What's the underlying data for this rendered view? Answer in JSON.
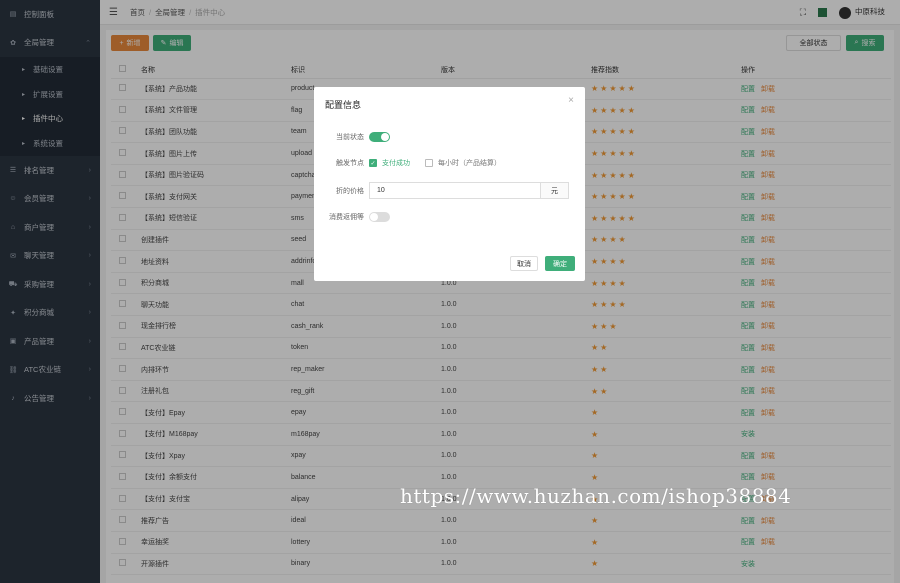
{
  "sidebar": {
    "items": [
      {
        "label": "控制面板",
        "icon": "dashboard-icon"
      },
      {
        "label": "全局管理",
        "icon": "gear-icon"
      }
    ],
    "subitems": [
      {
        "label": "基础设置"
      },
      {
        "label": "扩展设置"
      },
      {
        "label": "插件中心"
      },
      {
        "label": "系统设置"
      }
    ],
    "items2": [
      {
        "label": "排名管理",
        "icon": "list-icon"
      },
      {
        "label": "会员管理",
        "icon": "user-icon"
      },
      {
        "label": "商户管理",
        "icon": "store-icon"
      },
      {
        "label": "聊天管理",
        "icon": "chat-icon"
      },
      {
        "label": "采购管理",
        "icon": "cart-icon"
      },
      {
        "label": "积分商城",
        "icon": "gift-icon"
      },
      {
        "label": "产品管理",
        "icon": "box-icon"
      },
      {
        "label": "ATC农业链",
        "icon": "chain-icon"
      },
      {
        "label": "公告管理",
        "icon": "bell-icon"
      }
    ]
  },
  "topbar": {
    "crumbs": [
      "首页",
      "全局管理",
      "插件中心"
    ],
    "user": "中原科技"
  },
  "toolbar": {
    "btn1": "新增",
    "btn2": "编辑",
    "status_select": "全部状态",
    "search": "搜索"
  },
  "table": {
    "headers": [
      "名称",
      "标识",
      "版本",
      "推荐指数",
      "操作"
    ],
    "rows": [
      {
        "name": "【系统】产品功能",
        "key": "product",
        "ver": "",
        "stars": 5,
        "ops": [
          "配置",
          "卸载"
        ]
      },
      {
        "name": "【系统】文件管理",
        "key": "flag",
        "ver": "",
        "stars": 5,
        "ops": [
          "配置",
          "卸载"
        ]
      },
      {
        "name": "【系统】团队功能",
        "key": "team",
        "ver": "",
        "stars": 5,
        "ops": [
          "配置",
          "卸载"
        ]
      },
      {
        "name": "【系统】图片上传",
        "key": "upload",
        "ver": "",
        "stars": 5,
        "ops": [
          "配置",
          "卸载"
        ]
      },
      {
        "name": "【系统】图片验证码",
        "key": "captcha",
        "ver": "",
        "stars": 5,
        "ops": [
          "配置",
          "卸载"
        ]
      },
      {
        "name": "【系统】支付网关",
        "key": "payment",
        "ver": "",
        "stars": 5,
        "ops": [
          "配置",
          "卸载"
        ]
      },
      {
        "name": "【系统】短信验证",
        "key": "sms",
        "ver": "",
        "stars": 5,
        "ops": [
          "配置",
          "卸载"
        ]
      },
      {
        "name": "创建插件",
        "key": "seed",
        "ver": "",
        "stars": 4,
        "ops": [
          "配置",
          "卸载"
        ]
      },
      {
        "name": "地址资料",
        "key": "addrinfo",
        "ver": "",
        "stars": 4,
        "ops": [
          "配置",
          "卸载"
        ]
      },
      {
        "name": "积分商城",
        "key": "mall",
        "ver": "1.0.0",
        "stars": 4,
        "ops": [
          "配置",
          "卸载"
        ]
      },
      {
        "name": "聊天功能",
        "key": "chat",
        "ver": "1.0.0",
        "stars": 4,
        "ops": [
          "配置",
          "卸载"
        ]
      },
      {
        "name": "现金排行榜",
        "key": "cash_rank",
        "ver": "1.0.0",
        "stars": 3,
        "ops": [
          "配置",
          "卸载"
        ]
      },
      {
        "name": "ATC农业链",
        "key": "token",
        "ver": "1.0.0",
        "stars": 2,
        "ops": [
          "配置",
          "卸载"
        ]
      },
      {
        "name": "内排环节",
        "key": "rep_maker",
        "ver": "1.0.0",
        "stars": 2,
        "ops": [
          "配置",
          "卸载"
        ]
      },
      {
        "name": "注册礼包",
        "key": "reg_gift",
        "ver": "1.0.0",
        "stars": 2,
        "ops": [
          "配置",
          "卸载"
        ]
      },
      {
        "name": "【支付】Epay",
        "key": "epay",
        "ver": "1.0.0",
        "stars": 1,
        "ops": [
          "配置",
          "卸载"
        ]
      },
      {
        "name": "【支付】M168pay",
        "key": "m168pay",
        "ver": "1.0.0",
        "stars": 1,
        "ops": [
          "安装"
        ]
      },
      {
        "name": "【支付】Xpay",
        "key": "xpay",
        "ver": "1.0.0",
        "stars": 1,
        "ops": [
          "配置",
          "卸载"
        ]
      },
      {
        "name": "【支付】余额支付",
        "key": "balance",
        "ver": "1.0.0",
        "stars": 1,
        "ops": [
          "配置",
          "卸载"
        ]
      },
      {
        "name": "【支付】支付宝",
        "key": "alipay",
        "ver": "1.0.0",
        "stars": 1,
        "ops": [
          "配置",
          "卸载"
        ]
      },
      {
        "name": "推荐广告",
        "key": "ideal",
        "ver": "1.0.0",
        "stars": 1,
        "ops": [
          "配置",
          "卸载"
        ]
      },
      {
        "name": "幸运抽奖",
        "key": "lottery",
        "ver": "1.0.0",
        "stars": 1,
        "ops": [
          "配置",
          "卸载"
        ]
      },
      {
        "name": "开源插件",
        "key": "binary",
        "ver": "1.0.0",
        "stars": 1,
        "ops": [
          "安装"
        ]
      }
    ]
  },
  "modal": {
    "title": "配置信息",
    "status_label": "当前状态",
    "status_on": true,
    "node_label": "触发节点",
    "node_option1": "支付成功",
    "node_option2": "每小时（产品结算）",
    "price_label": "折的价格",
    "price_value": "10",
    "price_unit": "元",
    "extra_label": "消费返佣等",
    "extra_on": false,
    "cancel": "取消",
    "confirm": "确定"
  },
  "watermark": "https://www.huzhan.com/ishop38884",
  "colors": {
    "accent_green": "#3fae7a",
    "accent_orange": "#e98a3d",
    "star": "#f29a34",
    "sidebar_bg": "#2b3542"
  }
}
